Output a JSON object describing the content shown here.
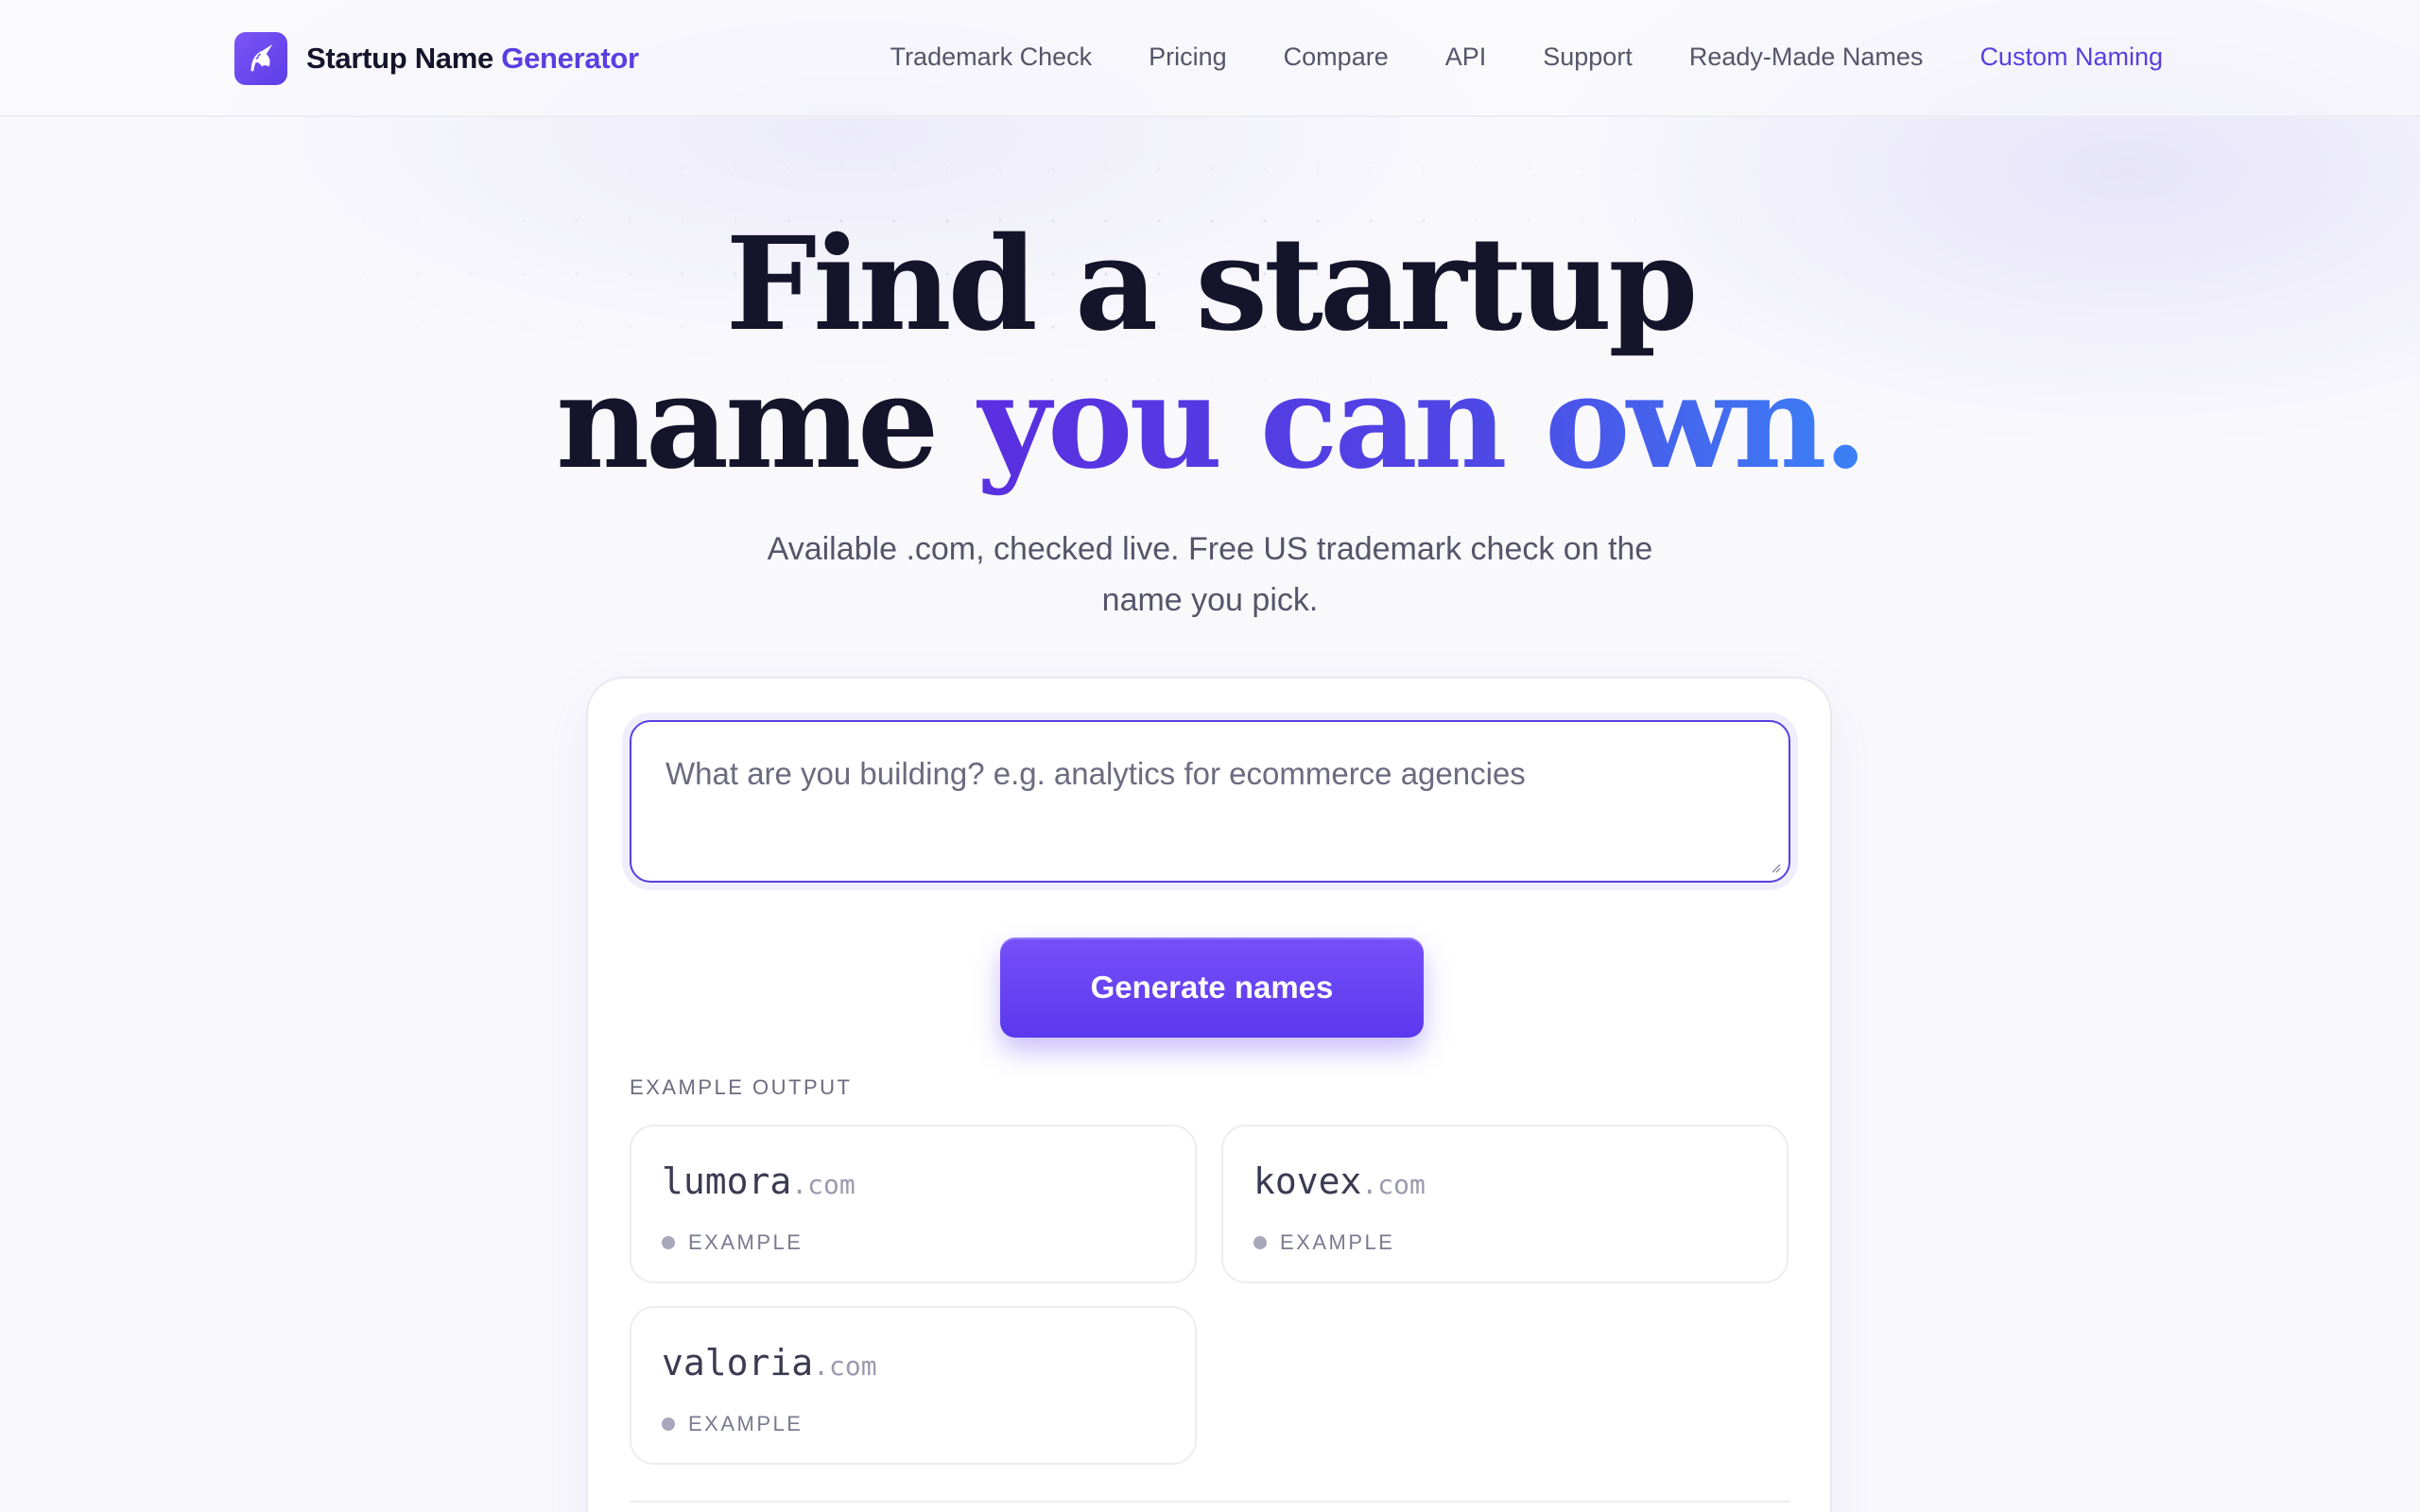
{
  "brand": {
    "name": "Startup Name",
    "accent": "Generator",
    "logo_icon": "unicorn-icon"
  },
  "nav": {
    "items": [
      {
        "label": "Trademark Check"
      },
      {
        "label": "Pricing"
      },
      {
        "label": "Compare"
      },
      {
        "label": "API"
      },
      {
        "label": "Support"
      },
      {
        "label": "Ready-Made Names"
      },
      {
        "label": "Custom Naming"
      }
    ]
  },
  "hero": {
    "line1": "Find a startup",
    "line2_plain": "name ",
    "line2_accent": "you can own.",
    "subtitle": "Available .com, checked live. Free US trademark check on the name you pick."
  },
  "form": {
    "placeholder": "What are you building? e.g. analytics for ecommerce agencies",
    "value": "",
    "button_label": "Generate names"
  },
  "examples": {
    "label": "EXAMPLE OUTPUT",
    "items": [
      {
        "name": "lumora",
        "tld": ".com",
        "tag": "EXAMPLE"
      },
      {
        "name": "kovex",
        "tld": ".com",
        "tag": "EXAMPLE"
      },
      {
        "name": "valoria",
        "tld": ".com",
        "tag": "EXAMPLE"
      }
    ]
  },
  "colors": {
    "accent": "#5a3ee0",
    "button": "#6a45f4",
    "text": "#14142b",
    "muted": "#55556a"
  }
}
